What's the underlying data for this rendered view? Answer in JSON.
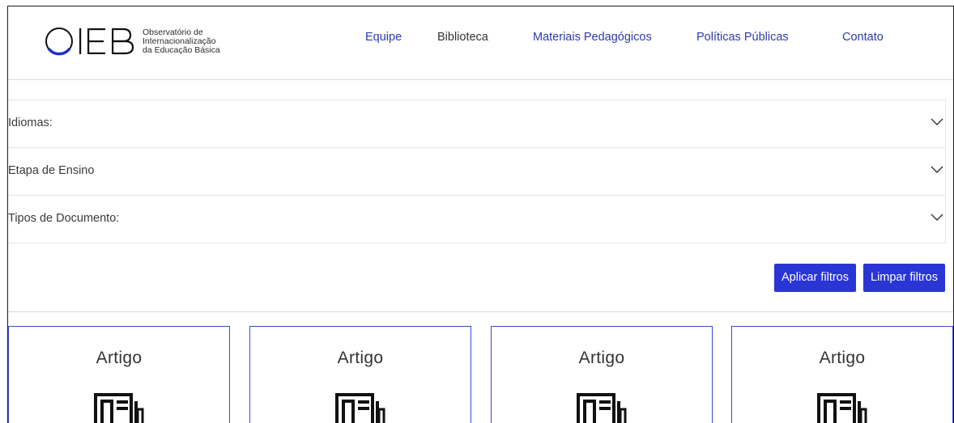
{
  "header": {
    "logo": {
      "mark": "OIEB",
      "line1": "Observatório de",
      "line2": "Internacionalização",
      "line3": "da Educação Básica"
    },
    "nav": [
      {
        "label": "Equipe"
      },
      {
        "label": "Biblioteca"
      },
      {
        "label": "Materiais Pedagógicos"
      },
      {
        "label": "Políticas Públicas"
      },
      {
        "label": "Contato"
      }
    ]
  },
  "filters": [
    {
      "label": "Idiomas:"
    },
    {
      "label": "Etapa de Ensino"
    },
    {
      "label": "Tipos de Documento:"
    }
  ],
  "actions": {
    "apply_label": "Aplicar filtros",
    "clear_label": "Limpar filtros"
  },
  "cards": [
    {
      "title": "Artigo",
      "icon": "newspaper-icon"
    },
    {
      "title": "Artigo",
      "icon": "newspaper-icon"
    },
    {
      "title": "Artigo",
      "icon": "newspaper-icon"
    },
    {
      "title": "Artigo",
      "icon": "newspaper-icon"
    }
  ],
  "colors": {
    "nav_link": "#2d3ab0",
    "button_bg": "#2a35d6",
    "card_border": "#3a4ad6",
    "logo_blue": "#1f2fc8"
  }
}
